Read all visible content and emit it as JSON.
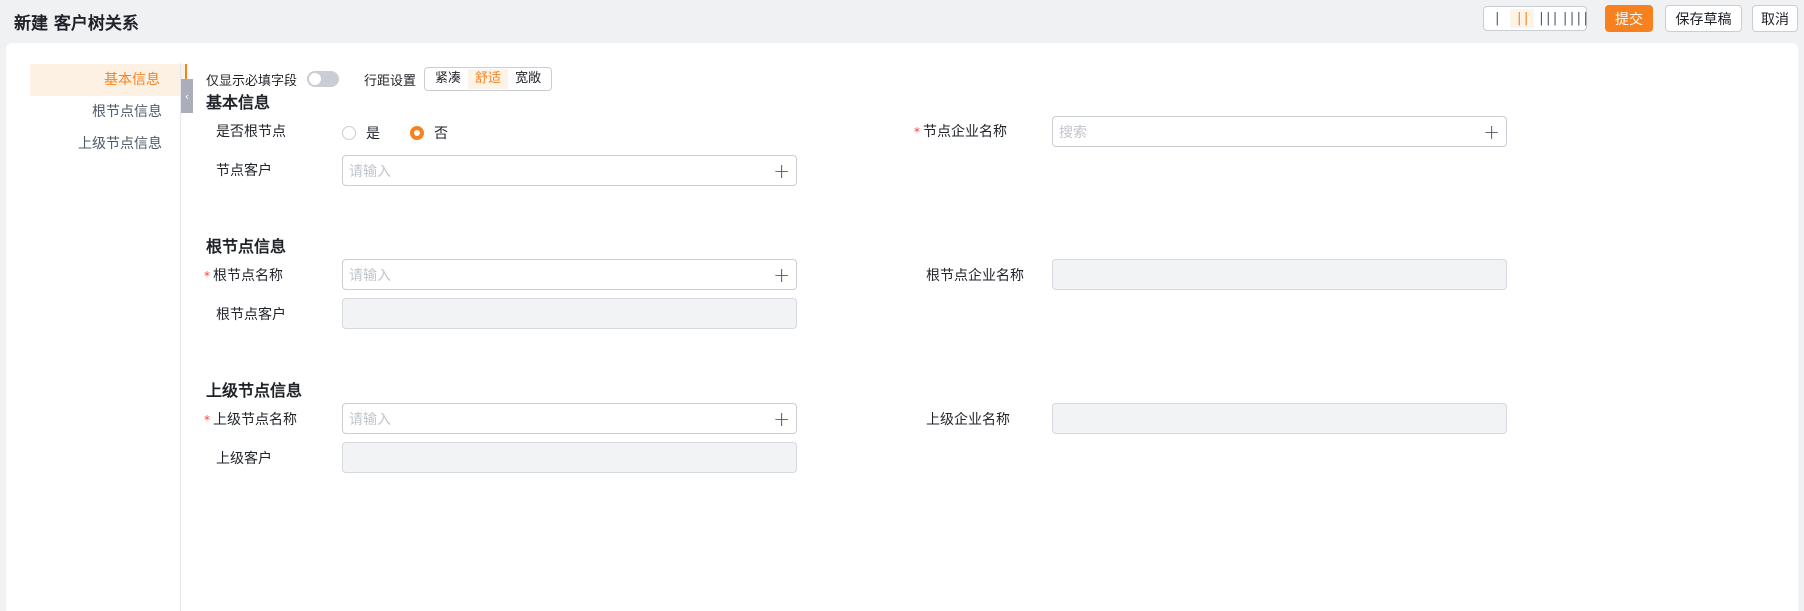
{
  "header": {
    "title": "新建 客户树关系",
    "column_options": [
      "|",
      "||",
      "|||",
      "||||"
    ],
    "column_active": 1,
    "submit_label": "提交",
    "draft_label": "保存草稿",
    "cancel_label": "取消"
  },
  "nav": {
    "items": [
      "基本信息",
      "根节点信息",
      "上级节点信息"
    ],
    "active": 0
  },
  "toolbar": {
    "required_only_label": "仅显示必填字段",
    "required_only_on": false,
    "spacing_label": "行距设置",
    "spacing_options": [
      "紧凑",
      "舒适",
      "宽敞"
    ],
    "spacing_active": 1
  },
  "sections": {
    "basic": {
      "title": "基本信息",
      "is_root_label": "是否根节点",
      "is_root_options": [
        "是",
        "否"
      ],
      "is_root_value": "否",
      "node_company_label": "节点企业名称",
      "node_company_placeholder": "搜索",
      "node_customer_label": "节点客户",
      "node_customer_placeholder": "请输入"
    },
    "root": {
      "title": "根节点信息",
      "root_name_label": "根节点名称",
      "root_name_placeholder": "请输入",
      "root_company_label": "根节点企业名称",
      "root_customer_label": "根节点客户"
    },
    "parent": {
      "title": "上级节点信息",
      "parent_name_label": "上级节点名称",
      "parent_name_placeholder": "请输入",
      "parent_company_label": "上级企业名称",
      "parent_customer_label": "上级客户"
    }
  },
  "required_mark": "*",
  "colors": {
    "accent": "#f7811e",
    "required": "#f53f3f"
  }
}
